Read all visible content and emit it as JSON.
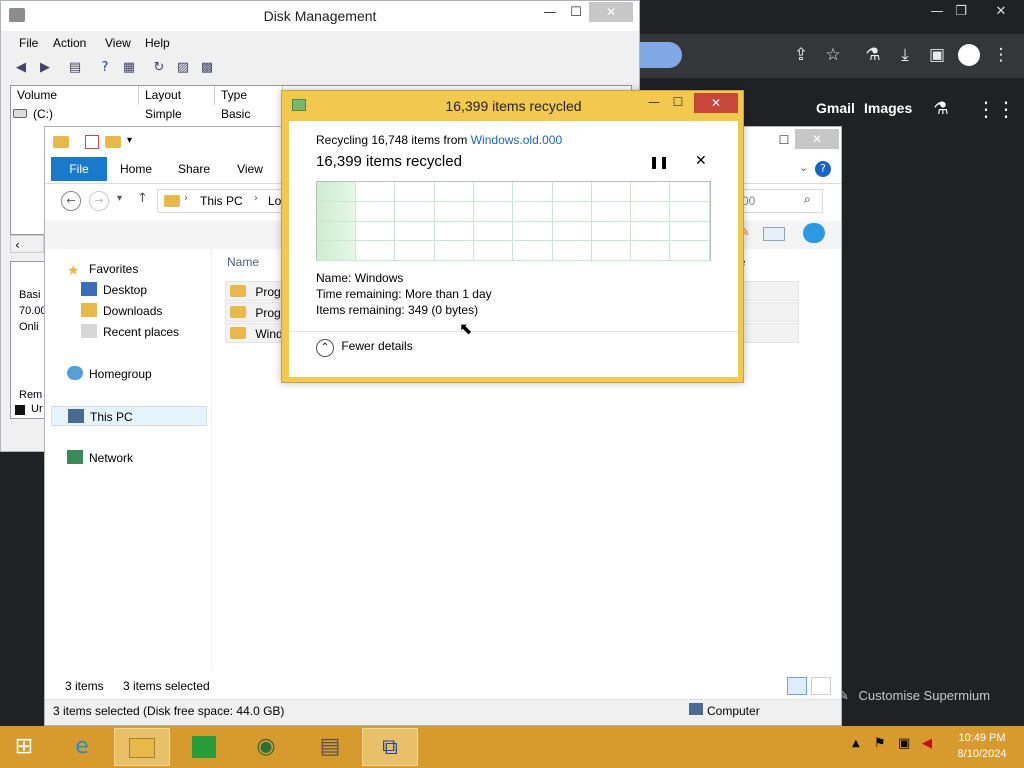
{
  "disk_management": {
    "title": "Disk Management",
    "menu": [
      "File",
      "Action",
      "View",
      "Help"
    ],
    "columns": [
      "Volume",
      "Layout",
      "Type"
    ],
    "rows": [
      {
        "volume": "(C:)",
        "layout": "Simple",
        "type": "Basic"
      }
    ],
    "left_labels": [
      "Basi",
      "70.00",
      "Onli",
      "Rem",
      "Ur"
    ]
  },
  "chrome": {
    "links": {
      "gmail": "Gmail",
      "images": "Images"
    },
    "customise": "Customise Supermium"
  },
  "explorer": {
    "ribbon_tabs": [
      "File",
      "Home",
      "Share",
      "View"
    ],
    "address": [
      "This PC",
      "Loc"
    ],
    "column_name": "Name",
    "column_right": "e",
    "search_value": "00",
    "nav": {
      "favorites": "Favorites",
      "desktop": "Desktop",
      "downloads": "Downloads",
      "recent": "Recent places",
      "homegroup": "Homegroup",
      "this_pc": "This PC",
      "network": "Network"
    },
    "files": [
      "Progra",
      "Progra",
      "Windo"
    ],
    "status_items": "3 items",
    "status_selected": "3 items selected",
    "bottom_status": "3 items selected (Disk free space: 44.0 GB)",
    "bottom_computer": "Computer"
  },
  "dialog": {
    "title": "16,399 items recycled",
    "recycling_prefix": "Recycling 16,748 items from ",
    "recycling_source": "Windows.old.000",
    "heading": "16,399 items recycled",
    "name_label": "Name:",
    "name_value": "Windows",
    "time_label": "Time remaining:",
    "time_value": "More than 1 day",
    "items_label": "Items remaining:",
    "items_value": "349 (0 bytes)",
    "fewer_details": "Fewer details",
    "progress_percent": 10
  },
  "taskbar": {
    "time": "10:49 PM",
    "date": "8/10/2024"
  },
  "colors": {
    "dialog_frame": "#f2c84f",
    "taskbar": "#d69a2d",
    "link": "#1a62c4"
  }
}
